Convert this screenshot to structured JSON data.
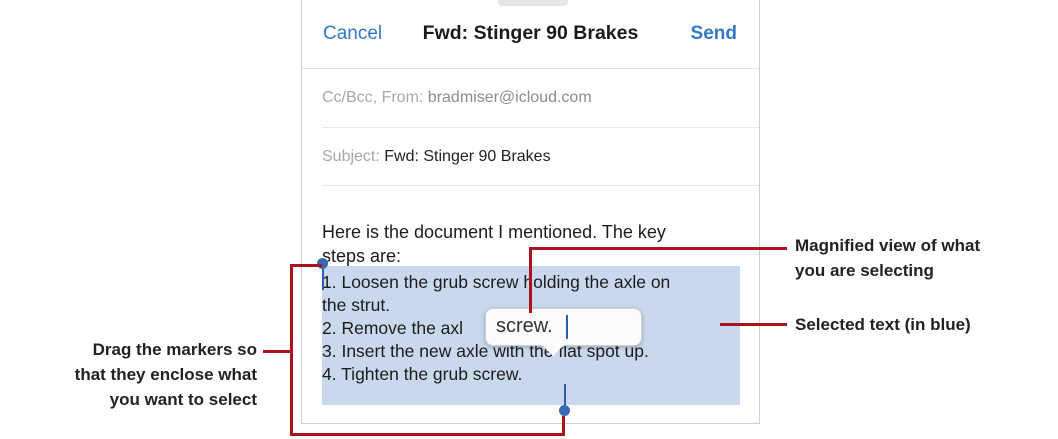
{
  "navbar": {
    "cancel_label": "Cancel",
    "title": "Fwd: Stinger 90 Brakes",
    "send_label": "Send"
  },
  "ccbcc": {
    "label": "Cc/Bcc, From:",
    "value": "bradmiser@icloud.com"
  },
  "subject": {
    "label": "Subject:",
    "value": "Fwd: Stinger 90 Brakes"
  },
  "body": {
    "intro_line1": "Here is the document I mentioned. The key",
    "intro_line2": "steps are:",
    "steps": [
      "1. Loosen the grub screw holding the axle on",
      "the strut.",
      "2. Remove the axl",
      "3. Insert the new axle with the flat spot up.",
      "4. Tighten the grub screw."
    ]
  },
  "magnifier": {
    "text": "screw."
  },
  "callouts": {
    "magnified_line1": "Magnified view of what",
    "magnified_line2": "you are selecting",
    "selected": "Selected text (in blue)",
    "drag_line1": "Drag the markers so",
    "drag_line2": "that they enclose what",
    "drag_line3": "you want to select"
  },
  "colors": {
    "accent": "#3478c6",
    "selection": "#c9d8ec",
    "callout_line": "#a8131e"
  }
}
